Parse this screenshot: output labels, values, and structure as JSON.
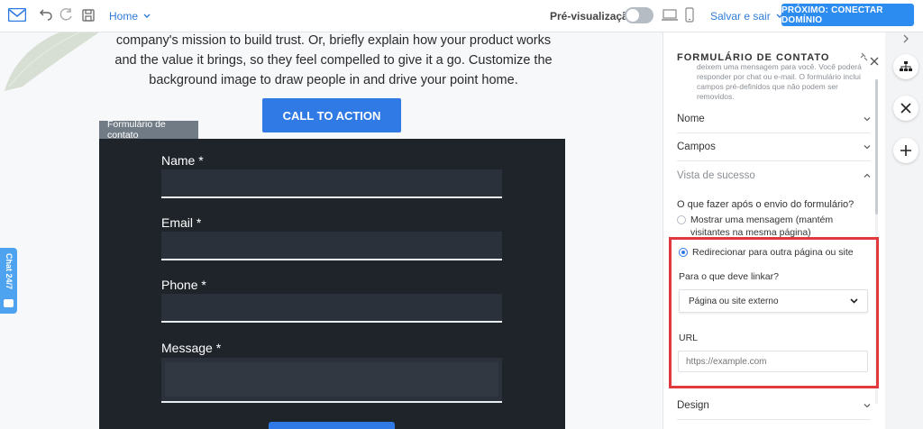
{
  "topbar": {
    "home_label": "Home",
    "preview_label": "Pré-visualização",
    "save_exit_label": "Salvar e sair",
    "next_button": "PRÓXIMO: CONECTAR DOMÍNIO",
    "preview_on": false
  },
  "canvas": {
    "hero_lines": [
      "company's mission to build trust. Or, briefly explain how your product works",
      "and the value it brings, so they feel compelled to give it a go. Customize the",
      "background image to draw people in and drive your point home."
    ],
    "cta_label": "CALL TO ACTION",
    "form_tag": "Formulário de contato",
    "fields": [
      {
        "label": "Name *"
      },
      {
        "label": "Email *"
      },
      {
        "label": "Phone *"
      },
      {
        "label": "Message *"
      }
    ],
    "chat_tab": "Chat 24/7"
  },
  "panel": {
    "title": "FORMULÁRIO DE CONTATO",
    "description": "deixem uma mensagem para você. Você poderá responder por chat ou e-mail. O formulário inclui campos pré-definidos que não podem ser removidos.",
    "sections": {
      "nome": "Nome",
      "campos": "Campos",
      "vista": "Vista de sucesso",
      "design": "Design"
    },
    "question": "O que fazer após o envio do formulário?",
    "options": [
      {
        "label": "Mostrar uma mensagem (mantém visitantes na mesma página)",
        "selected": false
      },
      {
        "label": "Redirecionar para outra página ou site",
        "selected": true
      }
    ],
    "link_question": "Para o que deve linkar?",
    "link_select_value": "Página ou site externo",
    "url_label": "URL",
    "url_placeholder": "https://example.com"
  },
  "colors": {
    "accent": "#2f7ae5",
    "next_button": "#2d8cf0",
    "highlight": "#e0393e",
    "form_bg": "#1f242b"
  }
}
